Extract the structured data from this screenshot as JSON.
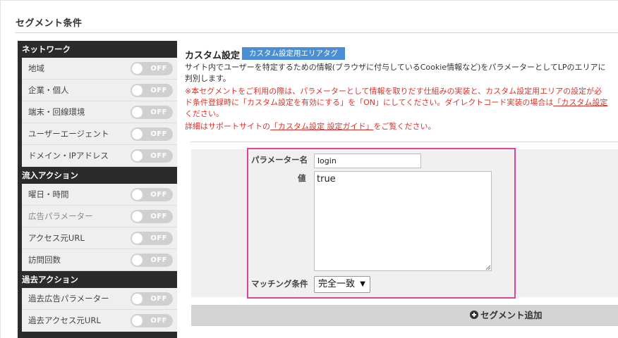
{
  "page": {
    "title": "セグメント条件"
  },
  "sidebar": {
    "toggle_label": "OFF",
    "categories": [
      {
        "header": "ネットワーク",
        "items": [
          "地域",
          "企業・個人",
          "端末・回線環境",
          "ユーザーエージェント",
          "ドメイン・IPアドレス"
        ]
      },
      {
        "header": "流入アクション",
        "items": [
          "曜日・時間",
          "広告パラメーター",
          "アクセス元URL",
          "訪問回数"
        ]
      },
      {
        "header": "過去アクション",
        "items": [
          "過去広告パラメーター",
          "過去アクセス元URL"
        ]
      }
    ]
  },
  "main": {
    "title": "カスタム設定",
    "tag_button": "カスタム設定用エリアタグ",
    "desc_line1": "サイト内でユーザーを特定するための情報(ブラウザに付与しているCookie情報など)をパラメーターとしてLPのエリアに",
    "desc_line2": "判別します。",
    "warn_line1": "※本セグメントをご利用の際は、パラメーターとして情報を取りだす仕組みの実装と、カスタム設定用エリアの設定が必",
    "warn_line2_pre": "ド条件登録時に「カスタム設定を有効にする」を「ON」にしてください。ダイレクトコード実装の場合は",
    "warn_line2_link": "「カスタム設定",
    "warn_line3": "ください。",
    "warn_line4_pre": "詳細はサポートサイトの",
    "warn_line4_link": "「カスタム設定 設定ガイド」",
    "warn_line4_post": "をご覧ください。"
  },
  "form": {
    "param_label": "パラメーター名",
    "param_value": "login",
    "value_label": "値",
    "value_text": "true",
    "matching_label": "マッチング条件",
    "matching_selected": "完全一致"
  },
  "actions": {
    "add_segment": "セグメント追加"
  },
  "colors": {
    "accent_blue": "#4a8fd3",
    "highlight_pink": "#e0449a",
    "warning_red": "#d9342b",
    "sidebar_dark": "#2b2b2b"
  }
}
